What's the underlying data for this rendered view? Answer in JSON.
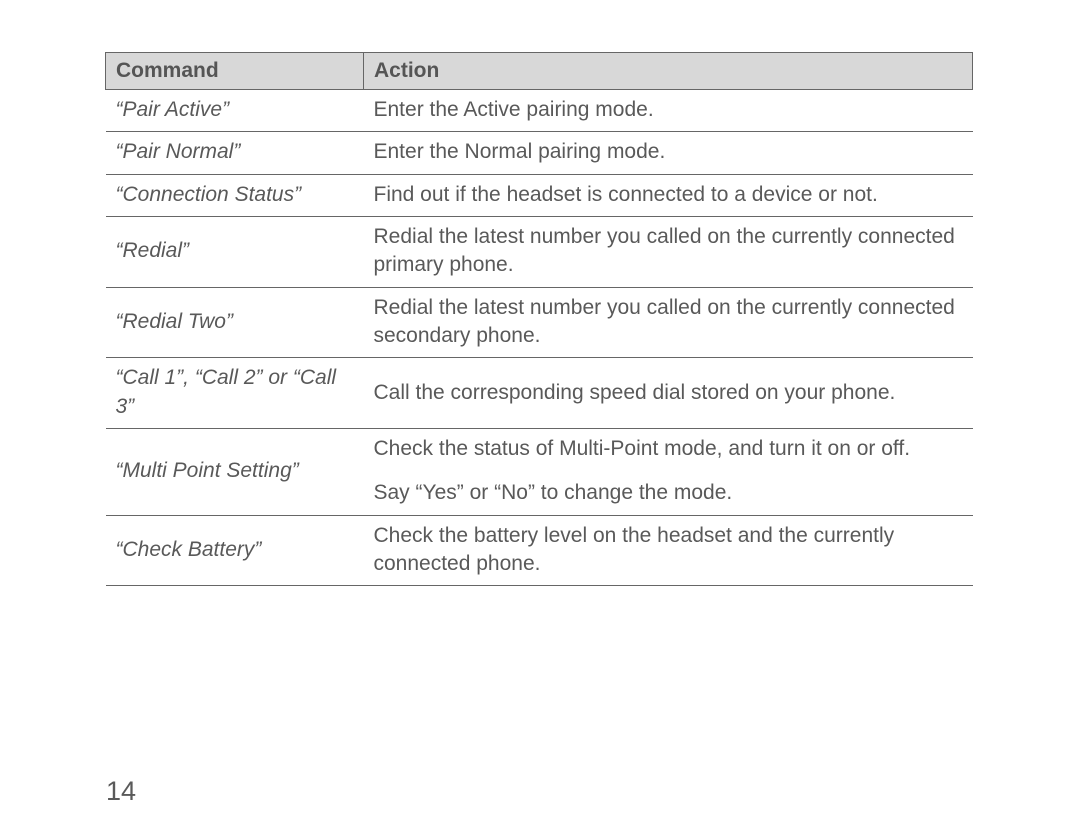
{
  "table": {
    "headers": {
      "command": "Command",
      "action": "Action"
    },
    "rows": [
      {
        "command": "“Pair Active”",
        "action": "Enter the Active pairing mode."
      },
      {
        "command": "“Pair Normal”",
        "action": "Enter the Normal pairing mode."
      },
      {
        "command": "“Connection Status”",
        "action": "Find out if the headset is connected to a device or not."
      },
      {
        "command": "“Redial”",
        "action": "Redial the latest number you called on the currently connected primary phone."
      },
      {
        "command": "“Redial Two”",
        "action": "Redial the latest number you called on the currently connected secondary phone."
      },
      {
        "command": "“Call 1”, “Call 2” or “Call 3”",
        "action": "Call the corresponding speed dial stored on your phone."
      },
      {
        "command": "“Multi Point Setting”",
        "action_p1": "Check the status of Multi-Point mode, and turn it on or off.",
        "action_p2": "Say “Yes” or “No” to change the mode."
      },
      {
        "command": "“Check Battery”",
        "action": "Check the battery level on the headset and the currently connected phone."
      }
    ]
  },
  "page_number": "14"
}
